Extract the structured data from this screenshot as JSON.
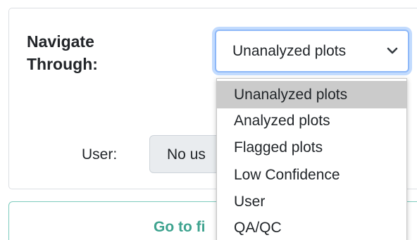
{
  "nav": {
    "label_line1": "Navigate",
    "label_line2": "Through:"
  },
  "select": {
    "value": "Unanalyzed plots",
    "chevron_icon": "chevron-down-icon",
    "options": [
      "Unanalyzed plots",
      "Analyzed plots",
      "Flagged plots",
      "Low Confidence",
      "User",
      "QA/QC"
    ]
  },
  "user": {
    "label": "User:",
    "input_value": "No us"
  },
  "goto_button": {
    "label": "Go to fi"
  },
  "colors": {
    "focus_border": "#8eb8f8",
    "selected_option_bg": "#cbcbcb",
    "button_border": "#7ccbbd",
    "button_text": "#3ea38f",
    "disabled_input_bg": "#e9ecef"
  }
}
